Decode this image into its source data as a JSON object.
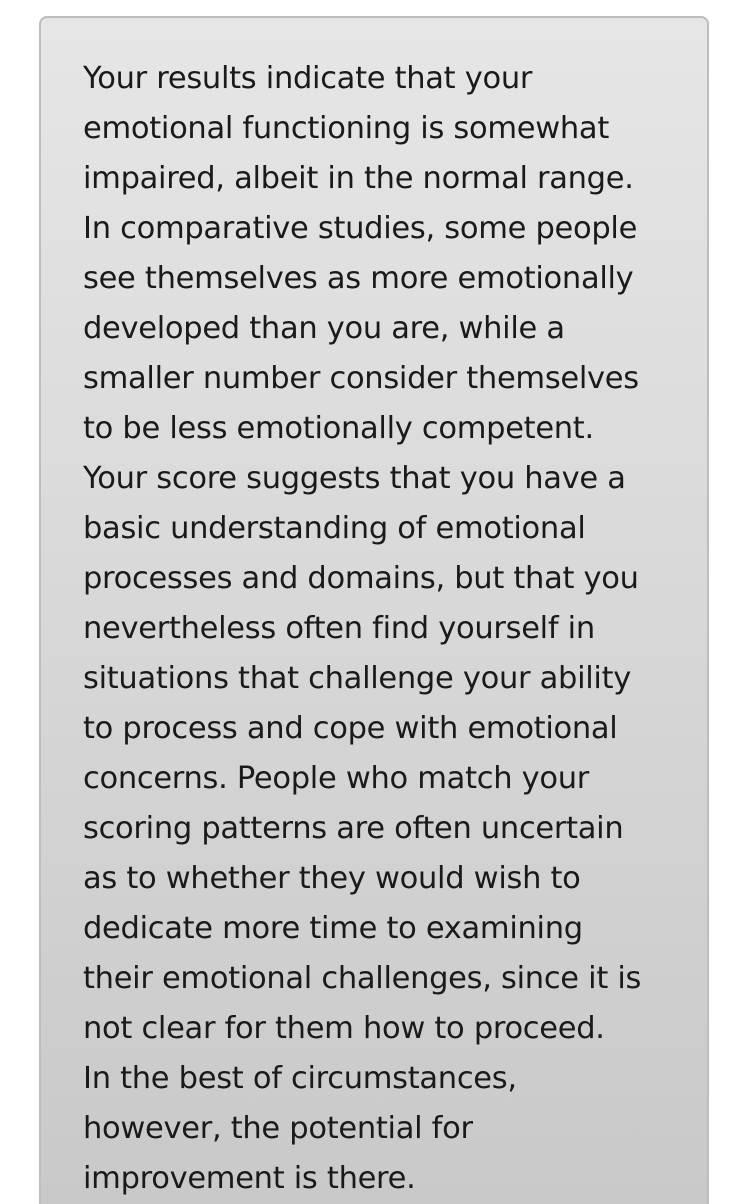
{
  "result": {
    "text": "Your results indicate that your\nemotional functioning is somewhat\nimpaired, albeit in the normal range.\nIn comparative studies, some people\nsee themselves as more emotionally\ndeveloped than you are, while a\nsmaller number consider themselves\nto be less emotionally competent.\nYour score suggests that you have a\nbasic understanding of emotional\nprocesses and domains, but that you\nnevertheless often find yourself in\nsituations that challenge your ability\nto process and cope with emotional\nconcerns. People who match your\nscoring patterns are often uncertain\nas to whether they would wish to\ndedicate more time to examining\ntheir emotional challenges, since it is\nnot clear for them how to proceed.\nIn the best of circumstances,\nhowever, the potential for\nimprovement is there."
  }
}
